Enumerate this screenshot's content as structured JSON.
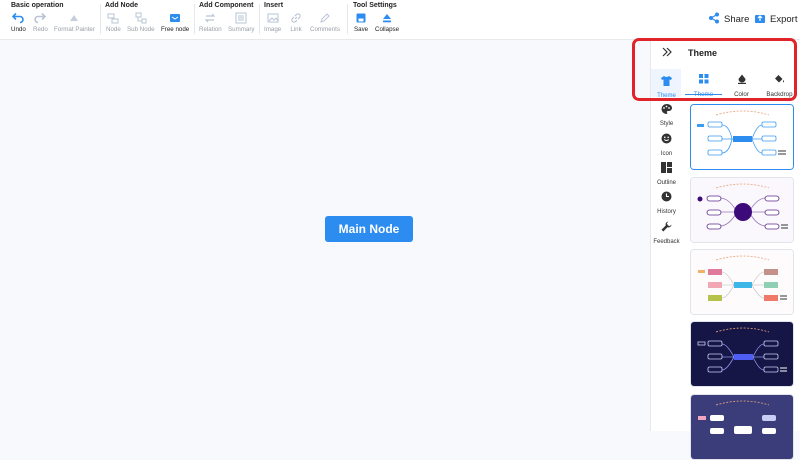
{
  "toolbar": {
    "groups": [
      {
        "title": "Basic operation",
        "tools": [
          {
            "label": "Undo",
            "icon": "undo-icon"
          },
          {
            "label": "Redo",
            "icon": "redo-icon"
          },
          {
            "label": "Format Painter",
            "icon": "format-painter-icon"
          }
        ]
      },
      {
        "title": "Add Node",
        "tools": [
          {
            "label": "Node",
            "icon": "node-icon"
          },
          {
            "label": "Sub Node",
            "icon": "sub-node-icon"
          },
          {
            "label": "Free node",
            "icon": "free-node-icon"
          }
        ]
      },
      {
        "title": "Add Component",
        "tools": [
          {
            "label": "Relation",
            "icon": "relation-icon"
          },
          {
            "label": "Summary",
            "icon": "summary-icon"
          }
        ]
      },
      {
        "title": "Insert",
        "tools": [
          {
            "label": "Image",
            "icon": "image-icon"
          },
          {
            "label": "Link",
            "icon": "link-icon"
          },
          {
            "label": "Comments",
            "icon": "comments-icon"
          }
        ]
      },
      {
        "title": "Tool Settings",
        "tools": [
          {
            "label": "Save",
            "icon": "save-icon"
          },
          {
            "label": "Collapse",
            "icon": "collapse-icon"
          }
        ]
      }
    ],
    "share_label": "Share",
    "export_label": "Export"
  },
  "canvas": {
    "main_node": "Main Node"
  },
  "rail": {
    "items": [
      {
        "label": "Theme",
        "icon": "shirt-icon",
        "active": true
      },
      {
        "label": "Style",
        "icon": "palette-icon"
      },
      {
        "label": "Icon",
        "icon": "smiley-icon"
      },
      {
        "label": "Outline",
        "icon": "outline-icon"
      },
      {
        "label": "History",
        "icon": "clock-icon"
      },
      {
        "label": "Feedback",
        "icon": "wrench-icon"
      }
    ]
  },
  "panel": {
    "title": "Theme",
    "tabs": [
      {
        "label": "Theme",
        "icon": "grid-icon",
        "active": true
      },
      {
        "label": "Color",
        "icon": "color-drop-icon"
      },
      {
        "label": "Backdrop",
        "icon": "paint-bucket-icon"
      }
    ],
    "themes": [
      {
        "name": "theme-light-blue",
        "bg": "#ffffff",
        "center": "#2d8cf0",
        "node": "#2d8cf0"
      },
      {
        "name": "theme-purple",
        "bg": "#faf8fc",
        "center": "#3d0a7a",
        "node": "#5a2a8a"
      },
      {
        "name": "theme-pastel",
        "bg": "#fdfbfb",
        "center": "#3fb6e8",
        "node": "#e98aa8"
      },
      {
        "name": "theme-navy",
        "bg": "#151646",
        "center": "#4e5ef5",
        "node": "#c9cdf5"
      },
      {
        "name": "theme-slate",
        "bg": "#3a3d7a",
        "center": "#ffffff",
        "node": "#f0a6c0"
      }
    ]
  },
  "colors": {
    "accent": "#2d8cf0",
    "highlight": "#e0242a"
  }
}
